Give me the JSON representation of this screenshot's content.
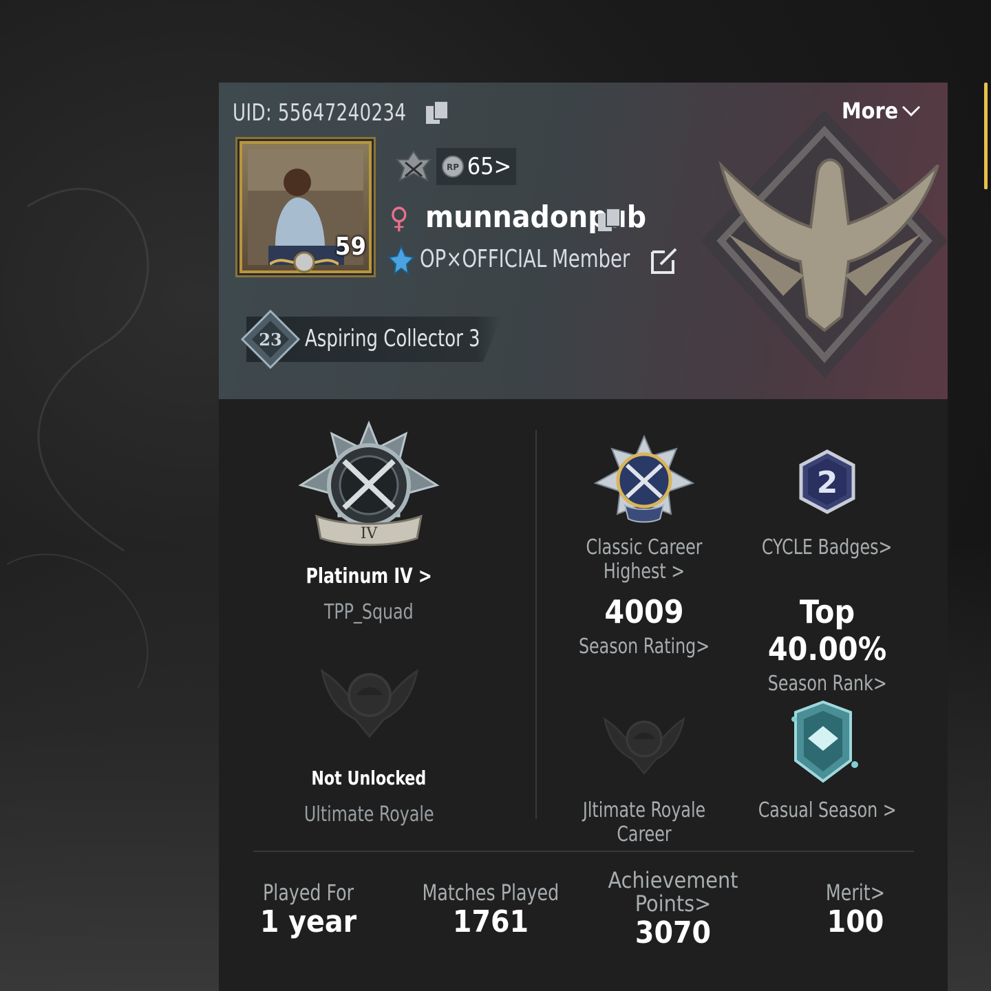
{
  "profile": {
    "uid_text": "UID: 55647240234",
    "more_label": "More",
    "avatar_level": "59",
    "rp_level": "65>",
    "player_name": "munnadonpub",
    "clan_name": "OP×OFFICIAL",
    "clan_role": "Member",
    "collector_level": "23",
    "collector_title": "Aspiring Collector 3"
  },
  "ranks": {
    "tpp_rank": "Platinum IV  >",
    "tpp_mode": "TPP_Squad",
    "ultimate_status": "Not Unlocked",
    "ultimate_mode": "Ultimate Royale",
    "classic_label": "Classic Career Highest >",
    "cycle_number": "2",
    "cycle_label": "CYCLE Badges>",
    "season_rating_value": "4009",
    "season_rating_label": "Season Rating>",
    "season_rank_value": "Top 40.00%",
    "season_rank_label": "Season Rank>",
    "ur_career_label": "Jltimate Royale Career",
    "casual_label": "Casual Season >"
  },
  "stats": [
    {
      "label": "Played For",
      "value": "1 year"
    },
    {
      "label": "Matches Played",
      "value": "1761"
    },
    {
      "label_line1": "Achievement",
      "label_line2": "Points>",
      "value": "3070"
    },
    {
      "label": "Merit>",
      "value": "100"
    }
  ],
  "colors": {
    "accent_gold": "#e9c24a",
    "gender_pink": "#e8708a",
    "header_teal": "#3f4a4e",
    "header_maroon": "#5a3a44"
  }
}
